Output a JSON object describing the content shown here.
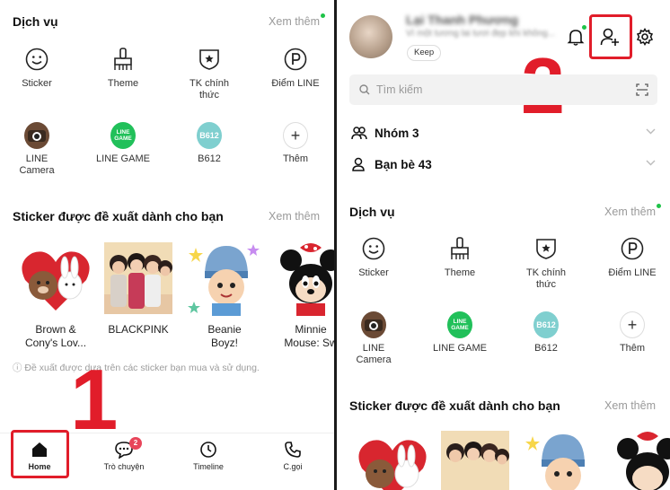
{
  "left": {
    "services": {
      "title": "Dịch vụ",
      "more": "Xem thêm",
      "items": [
        {
          "label": "Sticker",
          "icon": "smiley-icon"
        },
        {
          "label": "Theme",
          "icon": "brush-icon"
        },
        {
          "label": "TK chính thức",
          "icon": "official-shield-icon"
        },
        {
          "label": "Điểm LINE",
          "icon": "points-icon"
        },
        {
          "label": "LINE Camera",
          "icon": "line-camera-icon"
        },
        {
          "label": "LINE GAME",
          "icon": "line-game-icon",
          "logo_text": "LINE GAME"
        },
        {
          "label": "B612",
          "icon": "b612-icon",
          "logo_text": "B612"
        },
        {
          "label": "Thêm",
          "icon": "plus-icon"
        }
      ]
    },
    "stickers": {
      "title": "Sticker được đề xuất dành cho bạn",
      "more": "Xem thêm",
      "items": [
        {
          "name": "Brown & Cony's Lov...",
          "line1": "Brown &",
          "line2": "Cony's Lov..."
        },
        {
          "name": "BLACKPINK",
          "line1": "BLACKPINK",
          "line2": ""
        },
        {
          "name": "Beanie Boyz!",
          "line1": "Beanie",
          "line2": "Boyz!"
        },
        {
          "name": "Minnie Mouse: Sw",
          "line1": "Minnie",
          "line2": "Mouse: Sw"
        }
      ],
      "note": "ⓘ Đề xuất được dựa trên các sticker bạn mua và sử dụng."
    },
    "nav": {
      "items": [
        {
          "label": "Home",
          "icon": "home-icon",
          "active": true
        },
        {
          "label": "Trò chuyện",
          "icon": "chat-icon",
          "badge": "2"
        },
        {
          "label": "Timeline",
          "icon": "clock-icon"
        },
        {
          "label": "C.gọi",
          "icon": "phone-icon"
        }
      ]
    },
    "annotation_number": "1"
  },
  "right": {
    "profile": {
      "name": "Lại Thanh Phương",
      "status": "Vì một tương lai tươi đẹp khi không...",
      "keep_label": "Keep"
    },
    "header_icons": [
      "bell-icon",
      "add-friend-icon",
      "settings-icon"
    ],
    "search": {
      "placeholder": "Tìm kiếm"
    },
    "groups": {
      "label": "Nhóm 3"
    },
    "friends": {
      "label": "Bạn bè 43"
    },
    "services": {
      "title": "Dịch vụ",
      "more": "Xem thêm",
      "items": [
        {
          "label": "Sticker"
        },
        {
          "label": "Theme"
        },
        {
          "label": "TK chính thức"
        },
        {
          "label": "Điểm LINE"
        },
        {
          "label": "LINE Camera"
        },
        {
          "label": "LINE GAME"
        },
        {
          "label": "B612"
        },
        {
          "label": "Thêm"
        }
      ]
    },
    "stickers": {
      "title": "Sticker được đề xuất dành cho bạn",
      "more": "Xem thêm"
    },
    "annotation_number": "2"
  },
  "colors": {
    "accent_red": "#e11d2a",
    "line_green": "#1ec348",
    "badge_red": "#e8455a"
  }
}
